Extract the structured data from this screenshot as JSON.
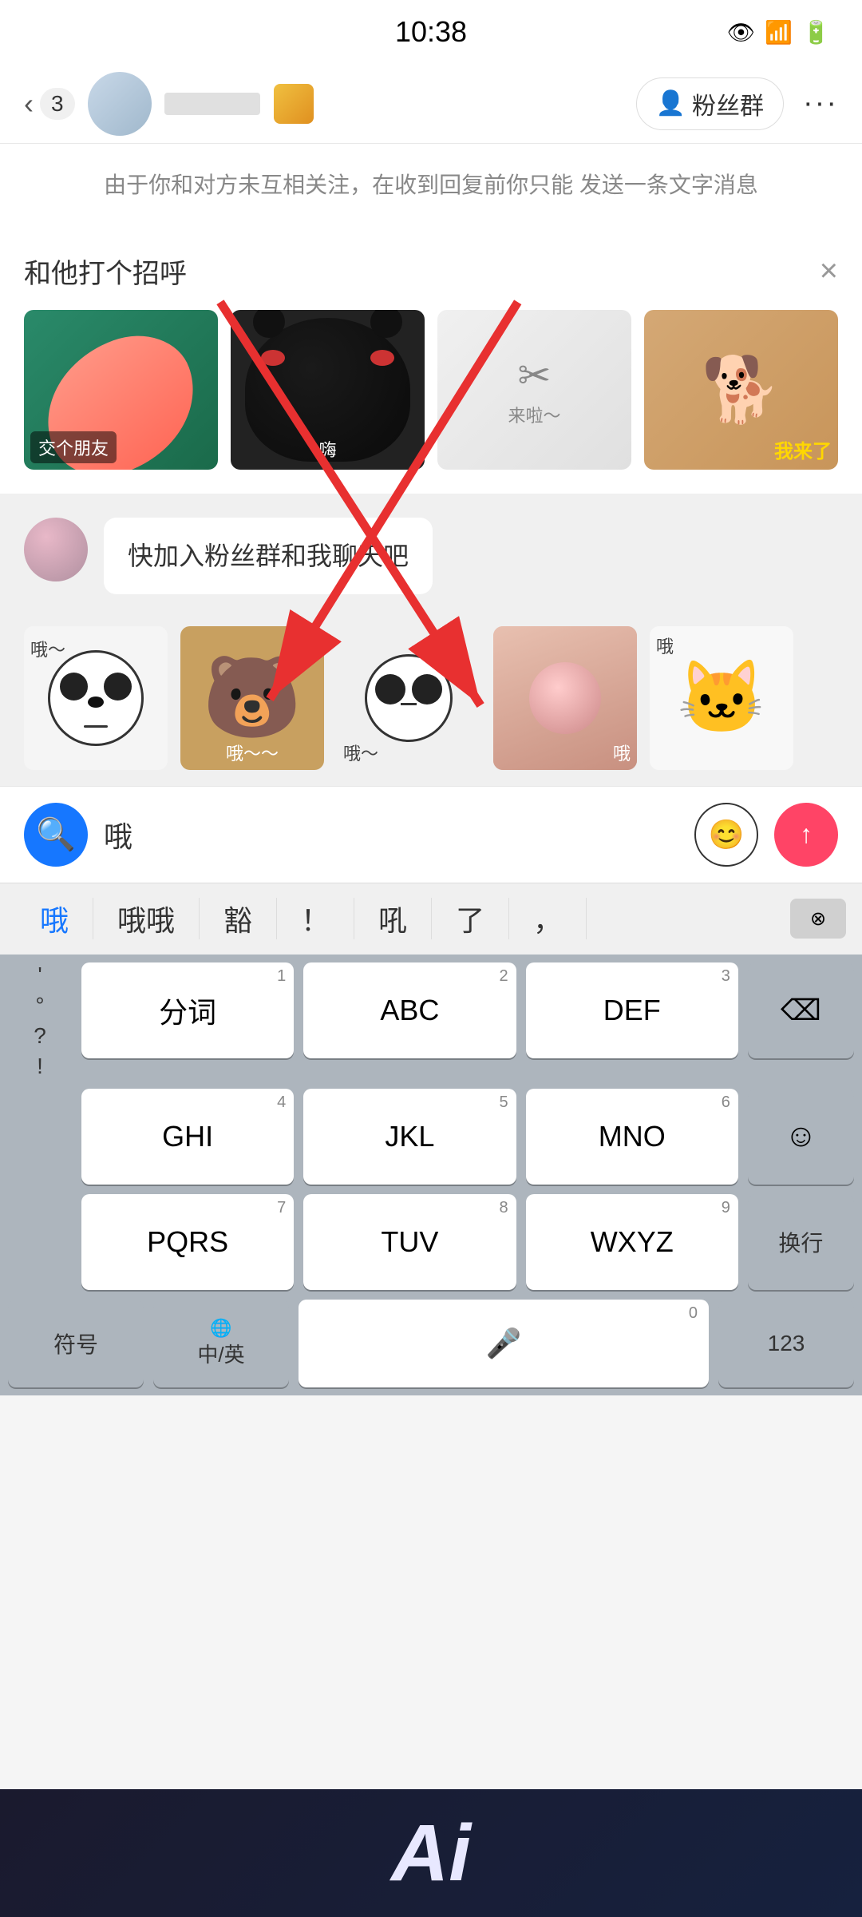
{
  "statusBar": {
    "time": "10:38",
    "icons": [
      "👁",
      "📶",
      "🔋"
    ]
  },
  "navBar": {
    "backLabel": "3",
    "userName": "",
    "fansBtnLabel": "粉丝群",
    "moreBtnLabel": "···"
  },
  "notice": {
    "text": "由于你和对方未互相关注，在收到回复前你只能\n发送一条文字消息"
  },
  "greetingPopup": {
    "title": "和他打个招呼",
    "closeLabel": "×"
  },
  "stickers": {
    "row1": [
      {
        "label": "交个朋友",
        "type": "hand"
      },
      {
        "label": "嗨",
        "type": "bear"
      },
      {
        "label": "来啦～",
        "type": "arrow"
      },
      {
        "label": "我来了",
        "type": "dog"
      }
    ],
    "row2": [
      {
        "label": "哦～",
        "type": "panda"
      },
      {
        "label": "哦～～",
        "type": "bear2"
      },
      {
        "label": "哦～",
        "type": "panda2"
      },
      {
        "label": "哦",
        "type": "girl"
      },
      {
        "label": "哦",
        "type": "cat"
      }
    ]
  },
  "message": {
    "text": "快加入粉丝群和我聊天吧"
  },
  "inputBar": {
    "value": "哦",
    "placeholder": "",
    "emojiBtnLabel": "😊",
    "sendBtnLabel": "↑"
  },
  "suggestions": {
    "items": [
      "哦",
      "哦哦",
      "豁",
      "！",
      "吼",
      "了",
      "，"
    ],
    "deleteLabel": "⊗"
  },
  "keyboard": {
    "rows": [
      {
        "leftPunct": [
          "'",
          "°",
          "?",
          "!"
        ],
        "keys": [
          {
            "main": "分词",
            "num": "1"
          },
          {
            "main": "ABC",
            "num": "2"
          },
          {
            "main": "DEF",
            "num": "3"
          }
        ],
        "rightKey": "⌫"
      },
      {
        "keys": [
          {
            "main": "GHI",
            "num": "4"
          },
          {
            "main": "JKL",
            "num": "5"
          },
          {
            "main": "MNO",
            "num": "6"
          }
        ],
        "rightKey": "😊"
      },
      {
        "keys": [
          {
            "main": "PQRS",
            "num": "7"
          },
          {
            "main": "TUV",
            "num": "8"
          },
          {
            "main": "WXYZ",
            "num": "9"
          }
        ],
        "rightKey": "换行"
      },
      {
        "bottomKeys": [
          "符号",
          "中/英",
          "🌐",
          "0",
          "123"
        ]
      }
    ],
    "zeroKey": "0",
    "micLabel": "🎤"
  }
}
